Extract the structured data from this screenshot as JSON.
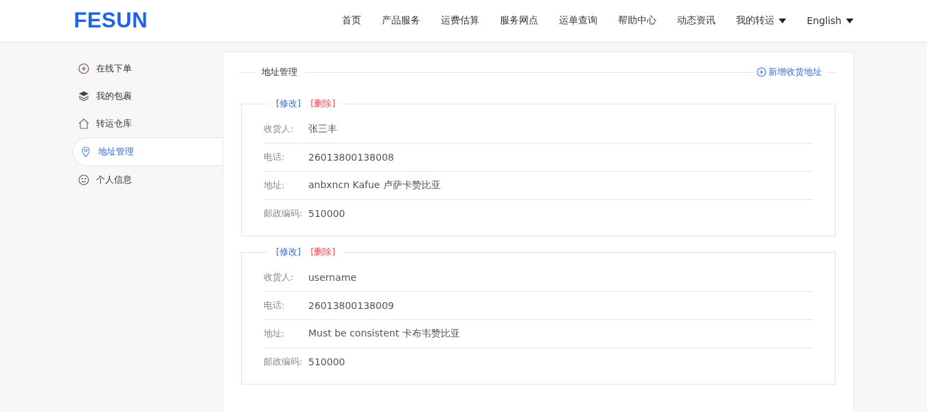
{
  "logo": "FESUN",
  "nav": [
    {
      "label": "首页",
      "dropdown": false
    },
    {
      "label": "产品服务",
      "dropdown": false
    },
    {
      "label": "运费估算",
      "dropdown": false
    },
    {
      "label": "服务网点",
      "dropdown": false
    },
    {
      "label": "运单查询",
      "dropdown": false
    },
    {
      "label": "帮助中心",
      "dropdown": false
    },
    {
      "label": "动态资讯",
      "dropdown": false
    },
    {
      "label": "我的转运",
      "dropdown": true
    },
    {
      "label": "English",
      "dropdown": true
    }
  ],
  "sidebar": {
    "items": [
      {
        "label": "在线下单",
        "kind": "plus",
        "selected": false
      },
      {
        "label": "我的包裹",
        "kind": "layers",
        "selected": false
      },
      {
        "label": "转运仓库",
        "kind": "house",
        "selected": false
      },
      {
        "label": "地址管理",
        "kind": "pin",
        "selected": true
      },
      {
        "label": "个人信息",
        "kind": "smile",
        "selected": false
      }
    ]
  },
  "panel": {
    "title": "地址管理",
    "add_button": "新增收货地址",
    "addresses": [
      {
        "edit": "[修改]",
        "delete": "[删除]",
        "fields": [
          {
            "label": "收货人:",
            "value": "张三丰"
          },
          {
            "label": "电话:",
            "value": "26013800138008"
          },
          {
            "label": "地址:",
            "value": "anbxncn Kafue 卢萨卡赞比亚"
          },
          {
            "label": "邮政编码:",
            "value": "510000"
          }
        ]
      },
      {
        "edit": "[修改]",
        "delete": "[删除]",
        "fields": [
          {
            "label": "收货人:",
            "value": "username"
          },
          {
            "label": "电话:",
            "value": "26013800138009"
          },
          {
            "label": "地址:",
            "value": "Must be consistent 卡布韦赞比亚"
          },
          {
            "label": "邮政编码:",
            "value": "510000"
          }
        ]
      }
    ]
  }
}
